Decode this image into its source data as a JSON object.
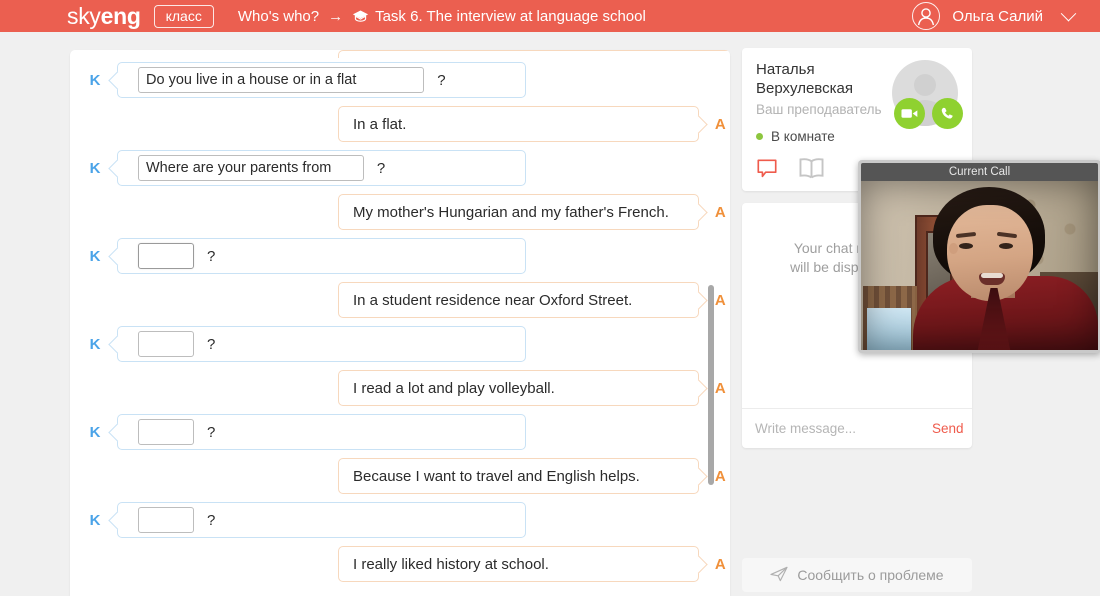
{
  "header": {
    "brand_light": "sky",
    "brand_bold": "eng",
    "klass_button": "класс",
    "breadcrumb_root": "Who's who?",
    "breadcrumb_arrow": "→",
    "breadcrumb_icon": "graduation-cap-icon",
    "breadcrumb_current": "Task 6. The interview at language school",
    "user_name": "Ольга Салий",
    "accent_color": "#eb5f50"
  },
  "exercise": {
    "question_marker": "K",
    "answer_marker": "A",
    "question_suffix": "?",
    "rows": [
      {
        "type": "answer-clipped"
      },
      {
        "type": "question",
        "value": "Do you live in a house or in a flat",
        "empty": false,
        "focused": false
      },
      {
        "type": "answer",
        "text": "In a flat."
      },
      {
        "type": "question",
        "value": "Where are your parents from",
        "empty": false,
        "focused": false
      },
      {
        "type": "answer",
        "text": "My mother's Hungarian and my father's French."
      },
      {
        "type": "question",
        "value": "",
        "empty": true,
        "focused": true
      },
      {
        "type": "answer",
        "text": "In a student residence near Oxford Street."
      },
      {
        "type": "question",
        "value": "",
        "empty": true,
        "focused": false
      },
      {
        "type": "answer",
        "text": "I read a lot and play volleyball."
      },
      {
        "type": "question",
        "value": "",
        "empty": true,
        "focused": false
      },
      {
        "type": "answer",
        "text": "Because I want to travel and English helps."
      },
      {
        "type": "question",
        "value": "",
        "empty": true,
        "focused": false
      },
      {
        "type": "answer",
        "text": "I really liked history at school."
      }
    ]
  },
  "teacher": {
    "name": "Наталья Верхулевская",
    "role": "Ваш преподаватель",
    "status": "В комнате",
    "status_color": "#8dc63f",
    "video_button": "video-camera-icon",
    "phone_button": "phone-icon",
    "chat_icon": "speech-bubble-icon",
    "book_icon": "open-book-icon"
  },
  "chat": {
    "empty_line1": "Your chat messages",
    "empty_line2": "will be displayed here",
    "input_placeholder": "Write message...",
    "input_value": "",
    "send_label": "Send",
    "send_color": "#ef5b4c"
  },
  "report": {
    "label": "Сообщить о проблеме",
    "icon": "paper-plane-icon"
  },
  "call_window": {
    "title": "Current Call"
  }
}
